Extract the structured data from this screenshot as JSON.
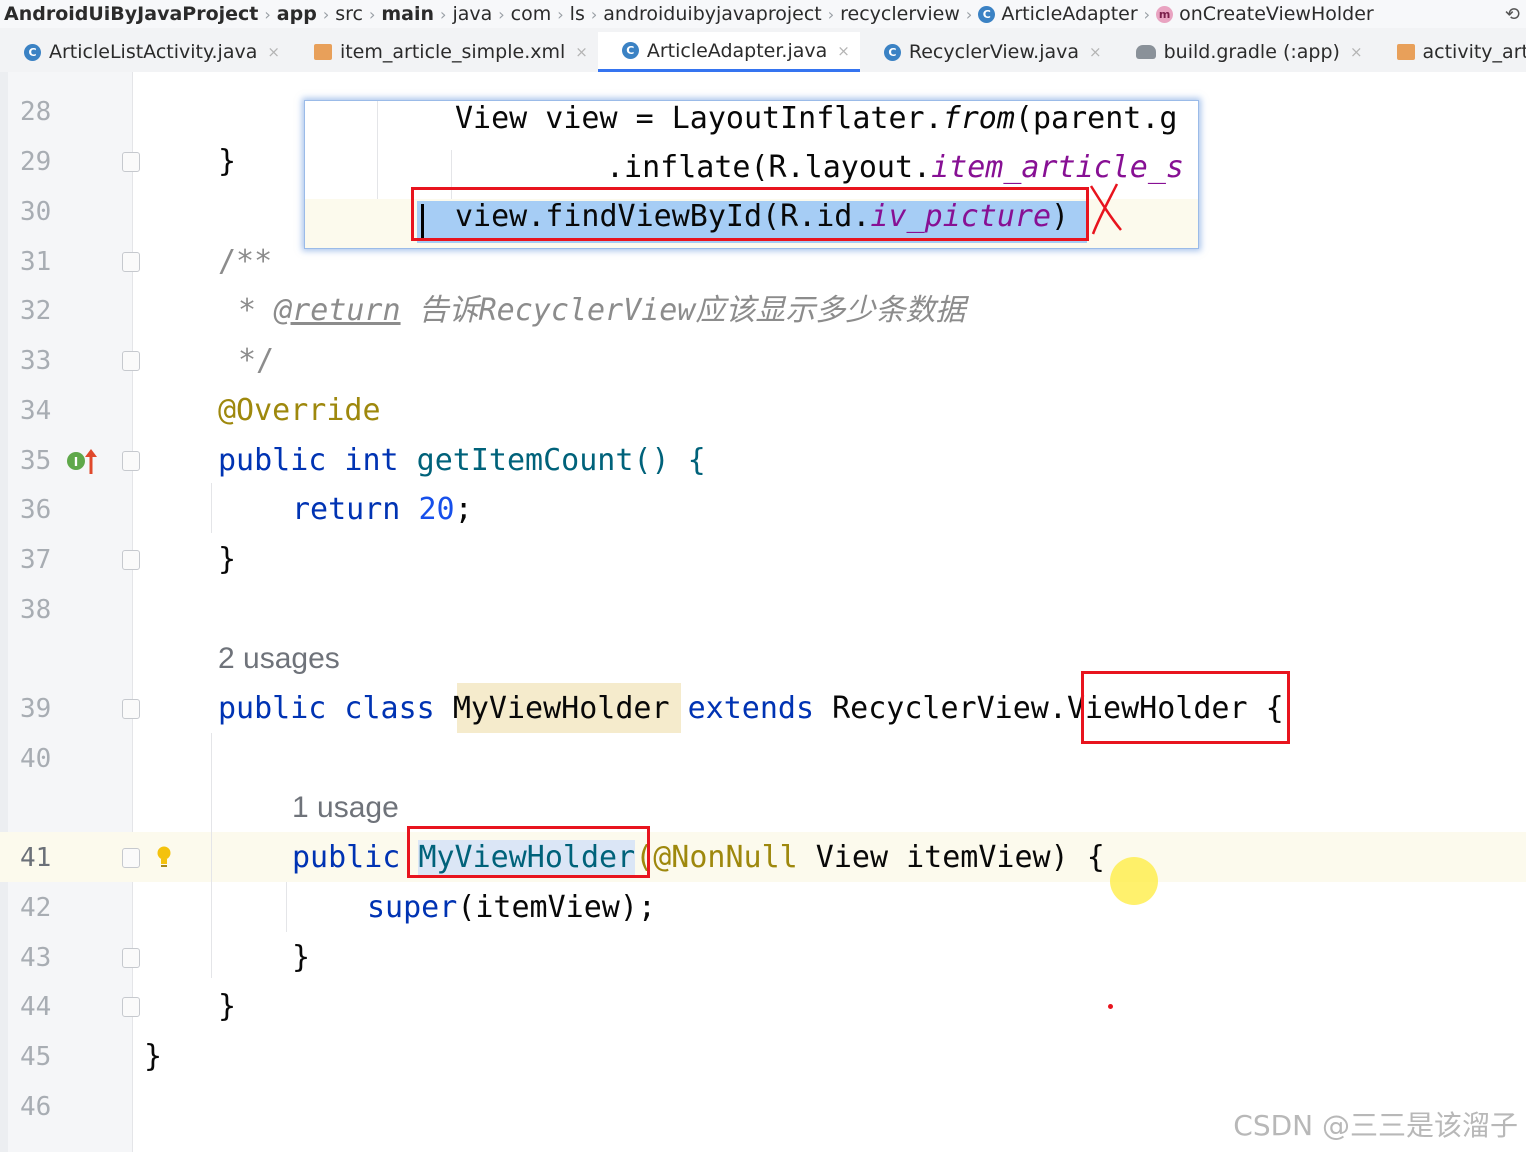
{
  "breadcrumb": {
    "items": [
      "AndroidUiByJavaProject",
      "app",
      "src",
      "main",
      "java",
      "com",
      "ls",
      "androiduibyjavaproject",
      "recyclerview",
      "ArticleAdapter",
      "onCreateViewHolder"
    ],
    "class_badge": "C",
    "method_badge": "m"
  },
  "tabs": [
    {
      "label": "ArticleListActivity.java",
      "icon": "java-class-icon",
      "active": false
    },
    {
      "label": "item_article_simple.xml",
      "icon": "xml-layout-icon",
      "active": false
    },
    {
      "label": "ArticleAdapter.java",
      "icon": "java-class-icon",
      "active": true
    },
    {
      "label": "RecyclerView.java",
      "icon": "java-class-icon",
      "active": false
    },
    {
      "label": "build.gradle (:app)",
      "icon": "gradle-icon",
      "active": false
    },
    {
      "label": "activity_article_list.xm",
      "icon": "xml-layout-icon",
      "active": false
    }
  ],
  "tab_close": "×",
  "gutter": {
    "lines": [
      "28",
      "29",
      "30",
      "31",
      "32",
      "33",
      "34",
      "35",
      "36",
      "37",
      "38",
      "39",
      "40",
      "41",
      "42",
      "43",
      "44",
      "45",
      "46"
    ]
  },
  "popup": {
    "line1": {
      "a": "View view = LayoutInflater.",
      "b": "from",
      "c": "(parent.g"
    },
    "line2": {
      "a": ".inflate(R.layout.",
      "b": "item_article_s"
    },
    "line3": {
      "a": "view.findViewById(R.id.",
      "b": "iv_picture",
      "c": ")"
    }
  },
  "code": {
    "l29": "}",
    "l31": "/**",
    "l32_star": "* ",
    "l32_tag": "@return",
    "l32_text": " 告诉RecyclerView应该显示多少条数据",
    "l33": "*/",
    "l34": "@Override",
    "l35_kw": "public int",
    "l35_rest": " getItemCount() {",
    "l36_kw": "return",
    "l36_num": "20",
    "l36_end": ";",
    "l37": "}",
    "usages_2": "2 usages",
    "l39_kw": "public class",
    "l39_name": "MyViewHolder",
    "l39_ext": "extends",
    "l39_rv": "RecyclerView.",
    "l39_vh": "ViewHolder",
    "l39_brace": "{",
    "usage_1": "1 usage",
    "l41_kw": "public",
    "l41_name": "MyViewHolder",
    "l41_ann": "(@NonNull",
    "l41_rest": " View itemView) {",
    "l42_kw": "super",
    "l42_rest": "(itemView);",
    "l43": "}",
    "l44": "}",
    "l45": "}"
  },
  "watermark": "CSDN @三三是该溜子"
}
